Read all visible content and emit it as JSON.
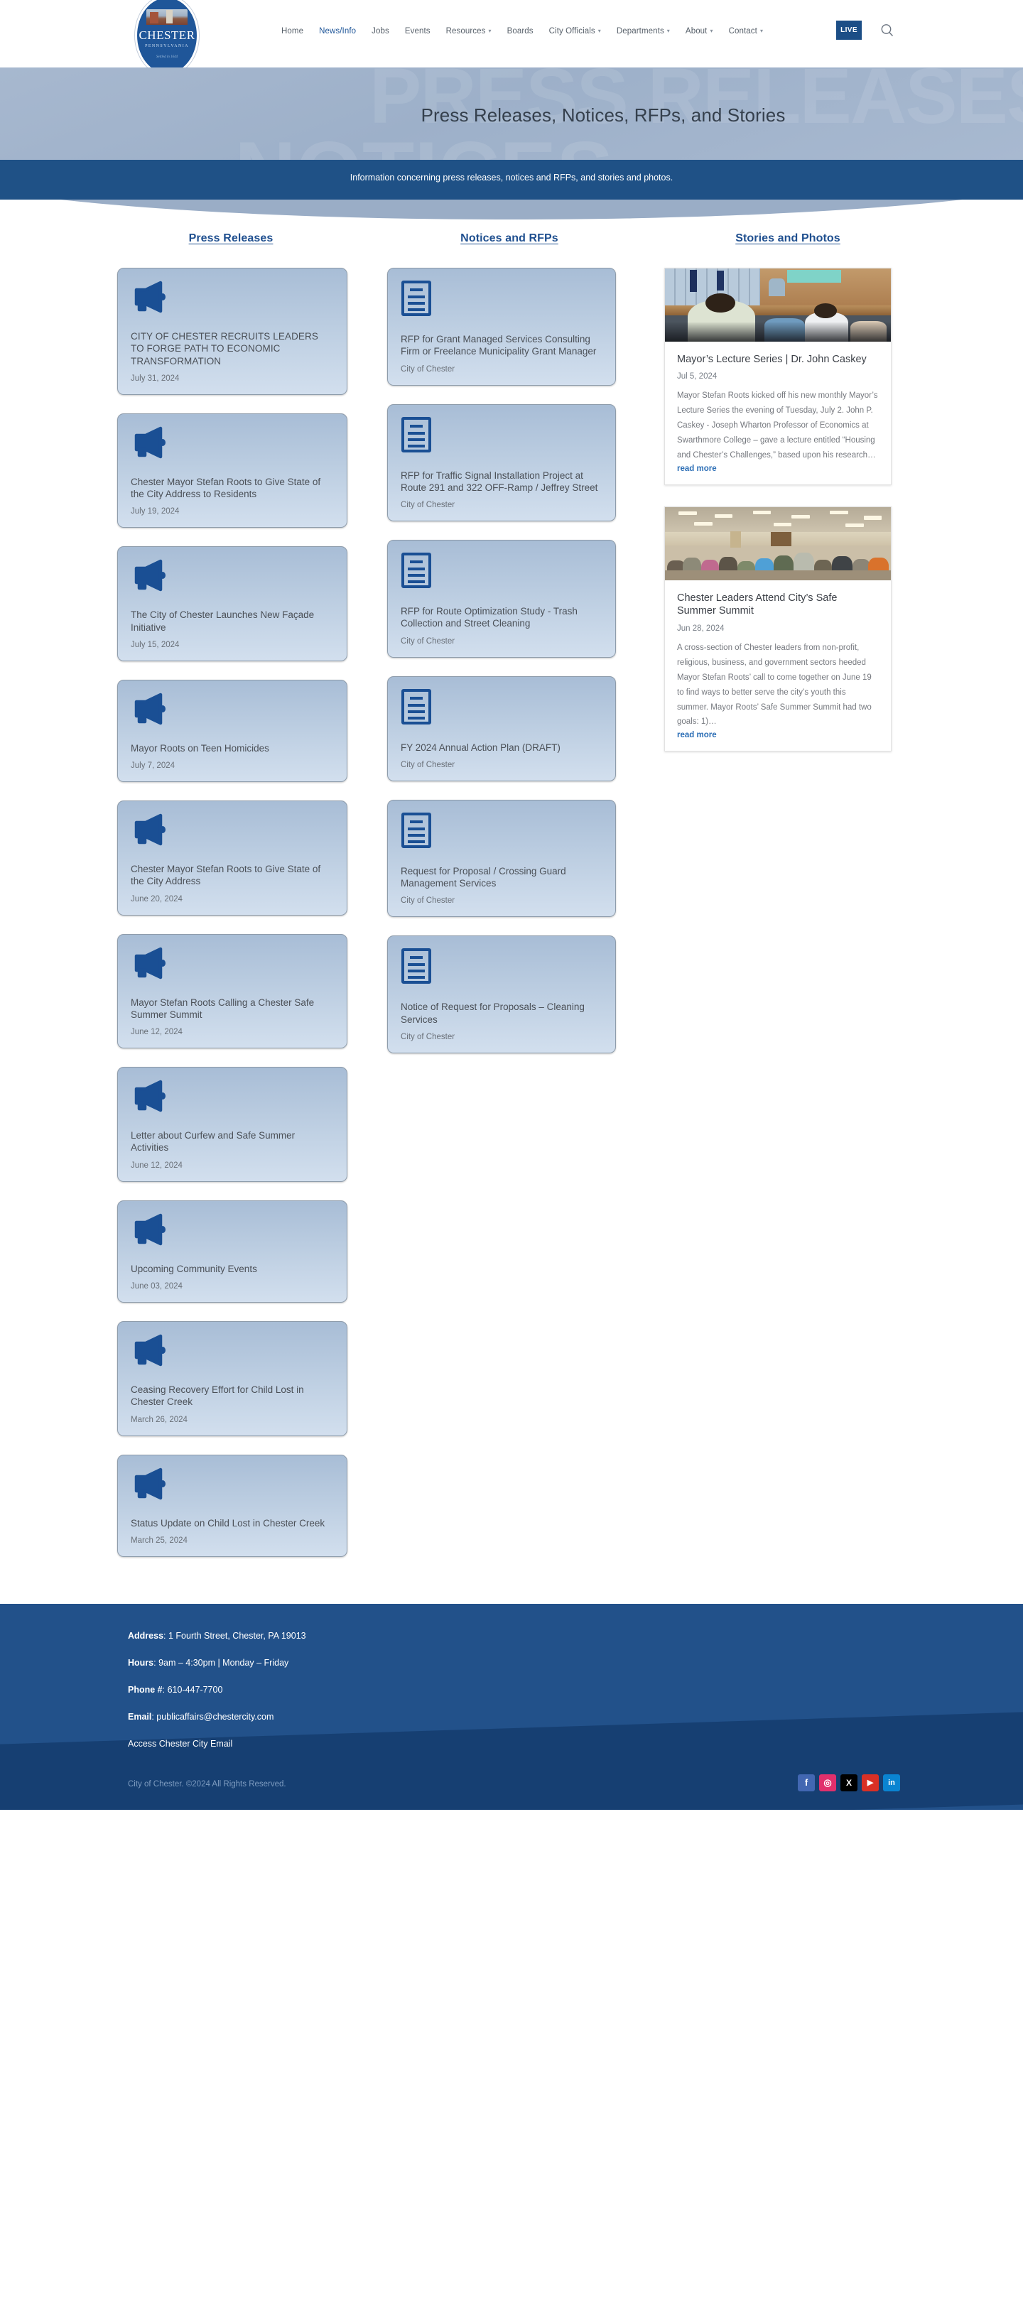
{
  "header": {
    "logo": {
      "name": "CHESTER",
      "state": "PENNSYLVANIA",
      "motto": "Settled in 1644"
    },
    "nav": [
      {
        "label": "Home",
        "active": false,
        "caret": false
      },
      {
        "label": "News/Info",
        "active": true,
        "caret": false
      },
      {
        "label": "Jobs",
        "active": false,
        "caret": false
      },
      {
        "label": "Events",
        "active": false,
        "caret": false
      },
      {
        "label": "Resources",
        "active": false,
        "caret": true
      },
      {
        "label": "Boards",
        "active": false,
        "caret": false
      },
      {
        "label": "City Officials",
        "active": false,
        "caret": true
      },
      {
        "label": "Departments",
        "active": false,
        "caret": true
      },
      {
        "label": "About",
        "active": false,
        "caret": true
      },
      {
        "label": "Contact",
        "active": false,
        "caret": true
      }
    ],
    "live_label": "LIVE",
    "search_icon": "search-icon"
  },
  "hero": {
    "title": "Press Releases, Notices, RFPs, and Stories",
    "ghost_text": "PRESS RELEASES",
    "ghost_text2": "NOTICES",
    "subtitle": "Information concerning press releases, notices and RFPs, and stories and photos."
  },
  "columns": {
    "press": {
      "heading": "Press Releases",
      "items": [
        {
          "title": "CITY OF CHESTER RECRUITS LEADERS TO FORGE PATH TO ECONOMIC TRANSFORMATION",
          "date": "July 31, 2024"
        },
        {
          "title": "Chester Mayor Stefan Roots to Give State of the City Address to Residents",
          "date": "July 19, 2024"
        },
        {
          "title": "The City of Chester Launches New Façade Initiative",
          "date": "July 15, 2024"
        },
        {
          "title": "Mayor Roots on Teen Homicides",
          "date": "July 7, 2024"
        },
        {
          "title": "Chester Mayor Stefan Roots to Give State of the City Address",
          "date": "June 20, 2024"
        },
        {
          "title": "Mayor Stefan Roots Calling a Chester Safe Summer Summit",
          "date": "June 12, 2024"
        },
        {
          "title": "Letter about Curfew and Safe Summer Activities",
          "date": "June 12, 2024"
        },
        {
          "title": "Upcoming Community Events",
          "date": "June 03, 2024"
        },
        {
          "title": "Ceasing Recovery Effort for Child Lost in Chester Creek",
          "date": "March 26, 2024"
        },
        {
          "title": "Status Update on Child Lost in Chester Creek",
          "date": "March 25, 2024"
        }
      ]
    },
    "rfp": {
      "heading": "Notices and RFPs",
      "items": [
        {
          "title": "RFP for Grant Managed Services Consulting Firm or Freelance Municipality Grant Manager",
          "source": "City of Chester"
        },
        {
          "title": "RFP for Traffic Signal Installation Project at Route 291 and 322 OFF-Ramp / Jeffrey Street",
          "source": "City of Chester"
        },
        {
          "title": "RFP for Route Optimization Study - Trash Collection and Street Cleaning",
          "source": "City of Chester"
        },
        {
          "title": "FY 2024 Annual Action Plan (DRAFT)",
          "source": "City of Chester"
        },
        {
          "title": "Request for Proposal / Crossing Guard Management Services",
          "source": "City of Chester"
        },
        {
          "title": "Notice of Request for Proposals – Cleaning Services",
          "source": "City of Chester"
        }
      ]
    },
    "stories": {
      "heading": "Stories and Photos",
      "items": [
        {
          "title": "Mayor’s Lecture Series | Dr. John Caskey",
          "date": "Jul 5, 2024",
          "excerpt": "Mayor Stefan Roots kicked off his new monthly Mayor’s Lecture Series the evening of Tuesday, July 2. John P. Caskey - Joseph Wharton Professor of Economics at Swarthmore College – gave a lecture entitled “Housing and Chester’s Challenges,” based upon his research…",
          "read_more": "read more",
          "image_alt": "lecture-hall-photo"
        },
        {
          "title": "Chester Leaders Attend City’s Safe Summer Summit",
          "date": "Jun 28, 2024",
          "excerpt": "A cross-section of Chester leaders from non-profit, religious, business, and government sectors heeded Mayor Stefan Roots’ call to come together on June 19 to find ways to better serve the city’s youth this summer. Mayor Roots’ Safe Summer Summit had two goals: 1)…",
          "read_more": "read more",
          "image_alt": "safe-summer-summit-photo"
        }
      ]
    }
  },
  "footer": {
    "address_label": "Address",
    "address_value": ": 1 Fourth Street, Chester, PA 19013",
    "hours_label": "Hours",
    "hours_value": ": 9am – 4:30pm | Monday – Friday",
    "phone_label": "Phone #",
    "phone_value": ": 610-447-7700",
    "email_label": "Email",
    "email_value": ": publicaffairs@chestercity.com",
    "access_email_link": "Access Chester City Email",
    "copyright": "City of Chester. ©2024 All Rights Reserved.",
    "socials": [
      {
        "name": "facebook-icon",
        "glyph": "f"
      },
      {
        "name": "instagram-icon",
        "glyph": "◎"
      },
      {
        "name": "x-twitter-icon",
        "glyph": "X"
      },
      {
        "name": "youtube-icon",
        "glyph": "▶"
      },
      {
        "name": "linkedin-icon",
        "glyph": "in"
      }
    ]
  },
  "colors": {
    "brand_blue": "#1f5699",
    "sub_bar": "#1f5186",
    "footer": "#22518a",
    "footer_dark": "#163f72",
    "link": "#2a6db5"
  }
}
